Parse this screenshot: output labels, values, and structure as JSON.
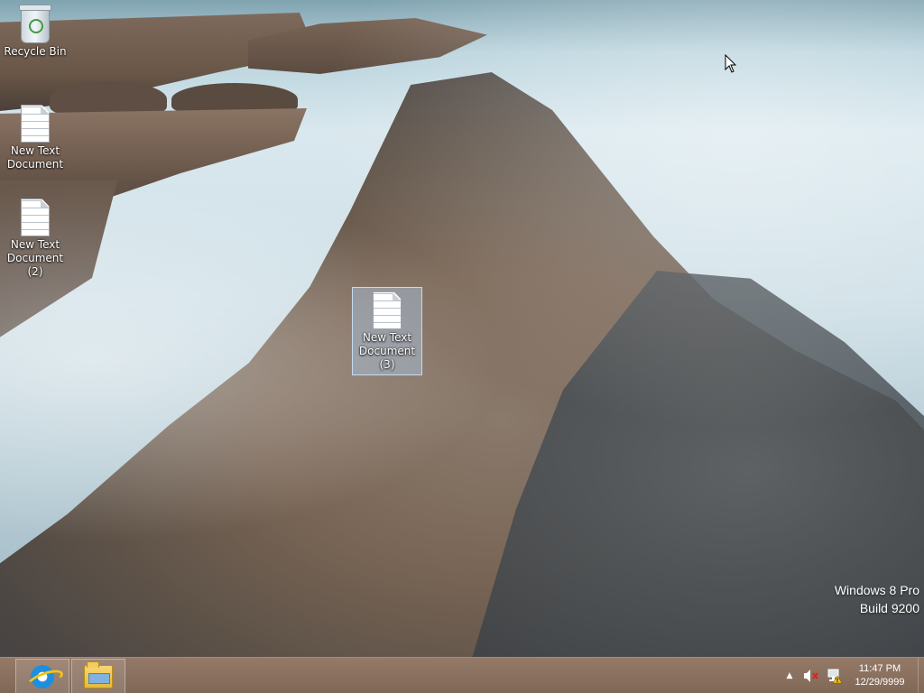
{
  "desktop": {
    "icons": [
      {
        "label": "Recycle Bin",
        "icon": "recycle-bin-icon"
      },
      {
        "label": "New Text Document",
        "icon": "text-document-icon"
      },
      {
        "label": "New Text Document (2)",
        "icon": "text-document-icon"
      },
      {
        "label": "New Text Document (3)",
        "icon": "text-document-icon",
        "selected": true
      }
    ]
  },
  "watermark": {
    "edition": "Windows 8 Pro",
    "build": "Build 9200"
  },
  "taskbar": {
    "pinned": [
      {
        "icon": "internet-explorer-icon"
      },
      {
        "icon": "file-explorer-icon"
      }
    ],
    "tray": {
      "icons": [
        "show-hidden-icons-chevron",
        "volume-muted-icon",
        "network-warning-icon"
      ],
      "time": "11:47 PM",
      "date": "12/29/9999"
    }
  },
  "colors": {
    "taskbar": "#8a6e5c",
    "selection": "#aac8e6"
  }
}
